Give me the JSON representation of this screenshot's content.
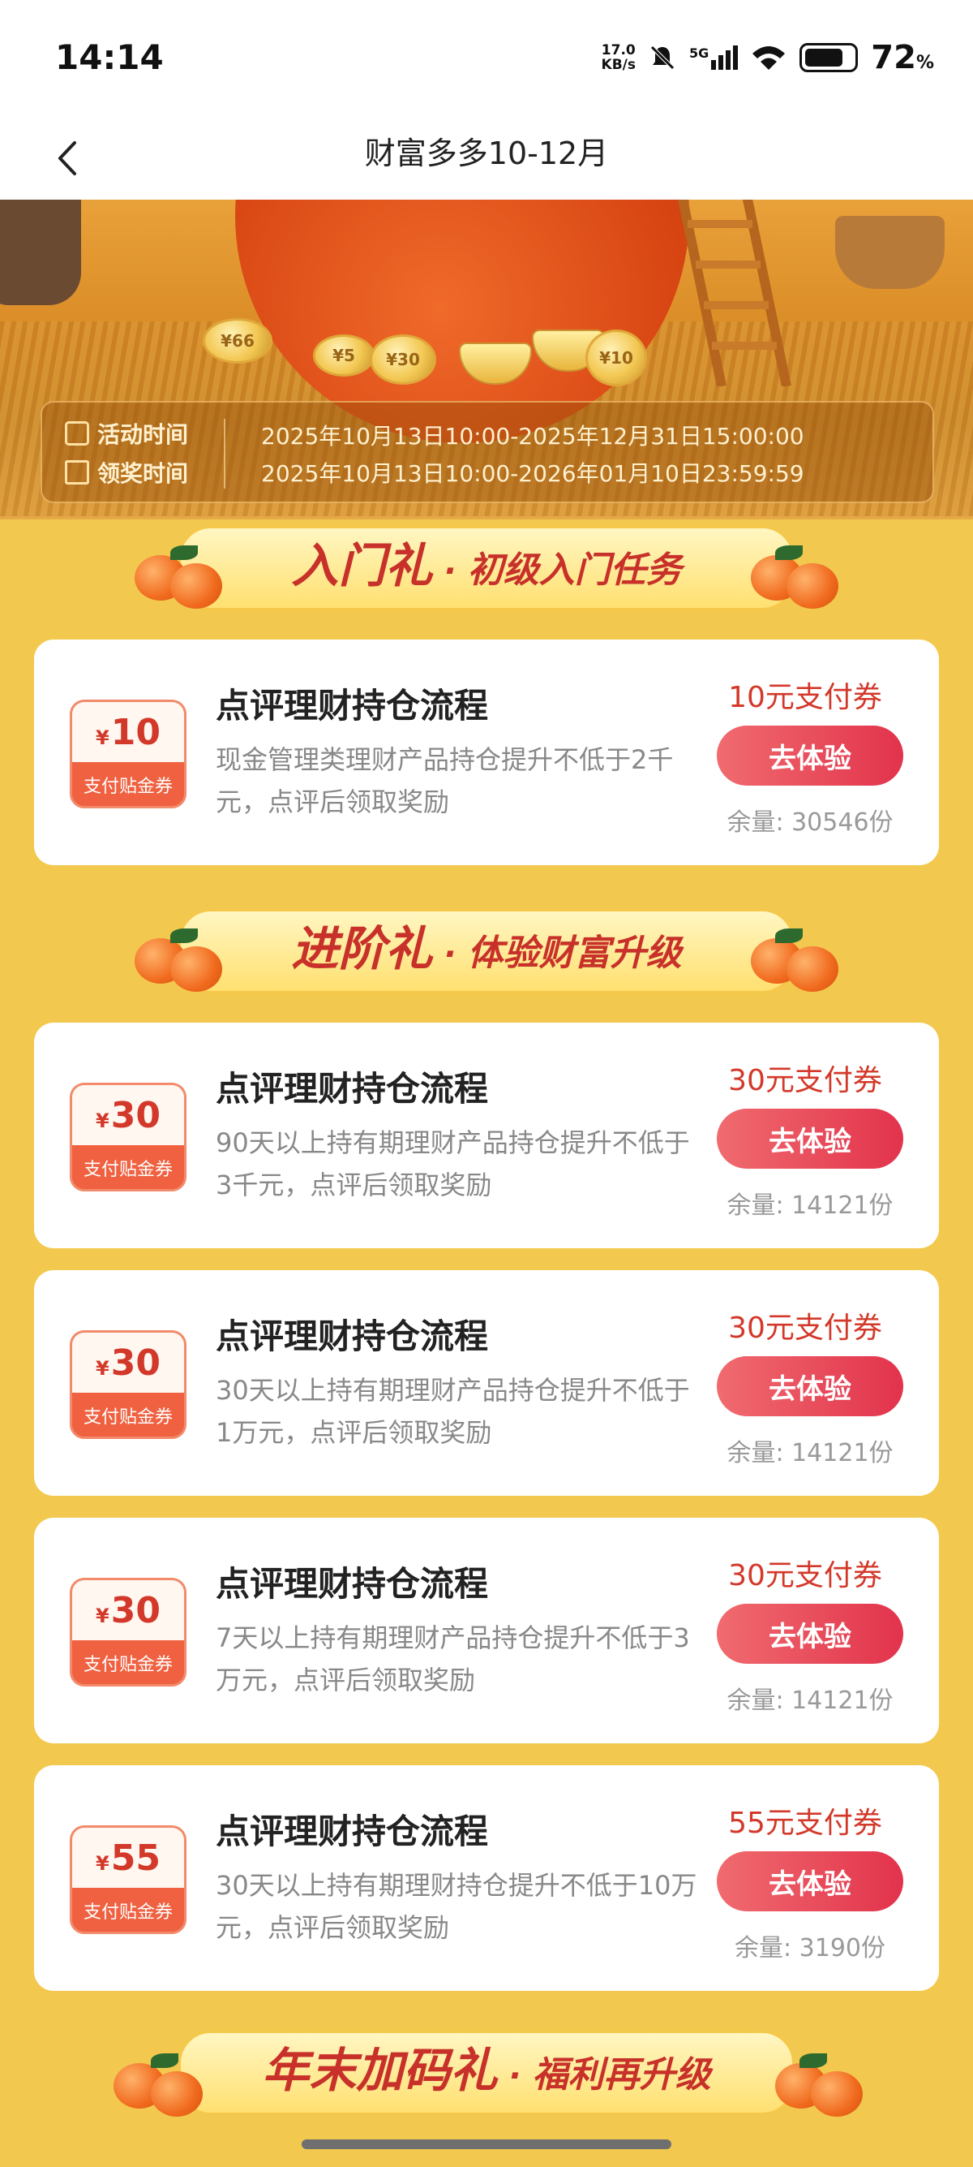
{
  "status_bar": {
    "time": "14:14",
    "net_speed_value": "17.0",
    "net_speed_unit": "KB/s",
    "network": "5G",
    "battery_value": "72",
    "battery_unit": "%"
  },
  "nav": {
    "title": "财富多多10-12月"
  },
  "hero": {
    "coins": [
      "¥66",
      "¥5",
      "¥30",
      "¥10"
    ],
    "activity_time_label": "活动时间",
    "activity_time": "2025年10月13日10:00-2025年12月31日15:00:00",
    "claim_time_label": "领奖时间",
    "claim_time": "2025年10月13日10:00-2026年01月10日23:59:59"
  },
  "sections": [
    {
      "main": "入门礼",
      "dot": "·",
      "sub": "初级入门任务"
    },
    {
      "main": "进阶礼",
      "dot": "·",
      "sub": "体验财富升级"
    },
    {
      "main": "年末加码礼",
      "dot": "·",
      "sub": "福利再升级"
    }
  ],
  "tasks": [
    {
      "coupon_yen": "¥",
      "coupon_amount": "10",
      "coupon_label": "支付贴金券",
      "title": "点评理财持仓流程",
      "desc": "现金管理类理财产品持仓提升不低于2千元，点评后领取奖励",
      "reward": "10元支付券",
      "button": "去体验",
      "stock": "余量: 30546份"
    },
    {
      "coupon_yen": "¥",
      "coupon_amount": "30",
      "coupon_label": "支付贴金券",
      "title": "点评理财持仓流程",
      "desc": "90天以上持有期理财产品持仓提升不低于3千元，点评后领取奖励",
      "reward": "30元支付券",
      "button": "去体验",
      "stock": "余量: 14121份"
    },
    {
      "coupon_yen": "¥",
      "coupon_amount": "30",
      "coupon_label": "支付贴金券",
      "title": "点评理财持仓流程",
      "desc": "30天以上持有期理财产品持仓提升不低于1万元，点评后领取奖励",
      "reward": "30元支付券",
      "button": "去体验",
      "stock": "余量: 14121份"
    },
    {
      "coupon_yen": "¥",
      "coupon_amount": "30",
      "coupon_label": "支付贴金券",
      "title": "点评理财持仓流程",
      "desc": "7天以上持有期理财产品持仓提升不低于3万元，点评后领取奖励",
      "reward": "30元支付券",
      "button": "去体验",
      "stock": "余量: 14121份"
    },
    {
      "coupon_yen": "¥",
      "coupon_amount": "55",
      "coupon_label": "支付贴金券",
      "title": "点评理财持仓流程",
      "desc": "30天以上持有期理财持仓提升不低于10万元，点评后领取奖励",
      "reward": "55元支付券",
      "button": "去体验",
      "stock": "余量: 3190份"
    }
  ]
}
